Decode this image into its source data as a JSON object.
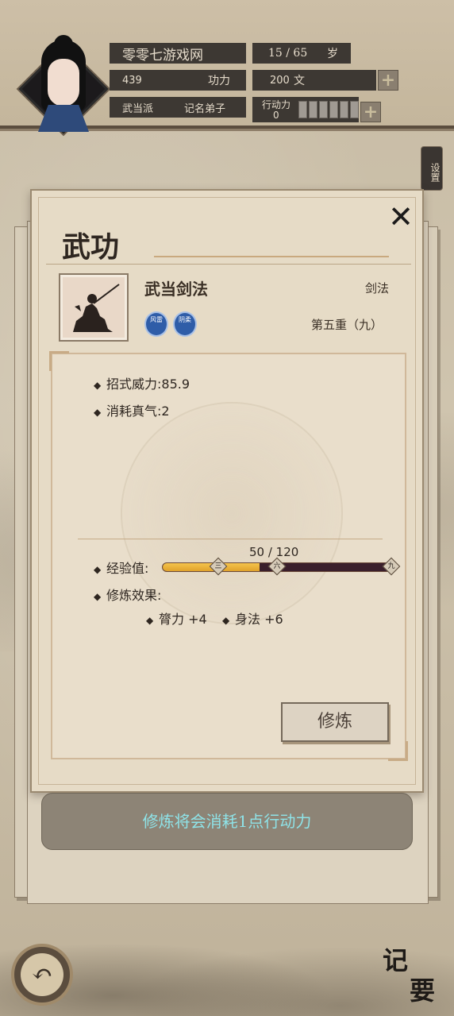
{
  "player": {
    "name": "零零七游戏网",
    "age": "15 / 65",
    "age_unit": "岁",
    "power_value": "439",
    "power_label": "功力",
    "money": "200",
    "money_unit": "文",
    "sect": "武当派",
    "rank": "记名弟子",
    "ap_label": "行动力",
    "ap_value": "0"
  },
  "settings_label": "设置",
  "panel": {
    "title": "武功",
    "skill_name": "武当剑法",
    "skill_type": "剑法",
    "skill_level": "第五重（九）",
    "badges": [
      {
        "icon": "badge-wind",
        "text": "风雷"
      },
      {
        "icon": "badge-yin",
        "text": "阴柔"
      }
    ],
    "stats": {
      "power_label": "招式威力:",
      "power_value": "85.9",
      "qi_label": "消耗真气:",
      "qi_value": "2"
    },
    "xp": {
      "label": "经验值:",
      "text": "50 / 120",
      "current": 50,
      "max": 120,
      "nodes": [
        "三",
        "六",
        "九"
      ]
    },
    "effects_label": "修炼效果:",
    "effects": [
      "膂力 +4",
      "身法 +6"
    ],
    "train_button": "修炼"
  },
  "hint": "修炼将会消耗1点行动力",
  "memo": [
    "记",
    "要"
  ],
  "colors": {
    "hint_text": "#8ee3e8",
    "xp_fill": "#f4c34c",
    "badge_blue": "#2f5da8"
  }
}
